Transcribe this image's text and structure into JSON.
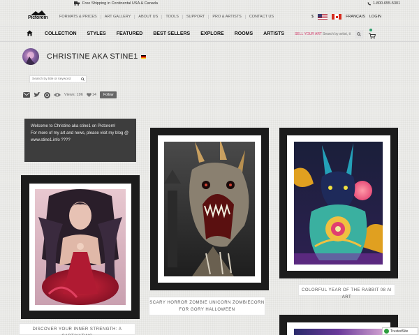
{
  "topbar": {
    "shipping": "Free Shipping in Continental USA & Canada",
    "phone": "1-800-655-5301"
  },
  "brand": {
    "logo": "Pictorem"
  },
  "toplinks": [
    "FORMATS & PRICES",
    "ART GALLERY",
    "ABOUT US",
    "TOOLS",
    "SUPPORT",
    "PRO & ARTISTS",
    "CONTACT US"
  ],
  "right_tools": {
    "currency": "$",
    "language": "FRANÇAIS",
    "login": "LOGIN"
  },
  "catnav": {
    "items": [
      "COLLECTION",
      "STYLES",
      "FEATURED",
      "BEST SELLERS",
      "EXPLORE",
      "ROOMS",
      "ARTISTS"
    ],
    "sell": "SELL YOUR ART",
    "search_placeholder": "Search by artist, ti"
  },
  "profile": {
    "name": "CHRISTINE AKA STINE1",
    "keyword_placeholder": "Search by title or keyword",
    "views": "Views: 196",
    "likes": "14",
    "follow": "Follow"
  },
  "welcome": {
    "lines": [
      "Welcome to Christine aka stine1 on Pictorem!",
      "For more of my art and news, please visit my blog @",
      "www.stine1.info ????"
    ]
  },
  "artworks": [
    {
      "caption_lines": [
        "DISCOVER YOUR INNER STRENGTH: A CAPTIVATING"
      ]
    },
    {
      "caption_lines": [
        "SCARY HORROR ZOMBIE UNICORN ZOMBIECORN",
        "FOR GORY HALLOWEEN"
      ]
    },
    {
      "caption_lines": [
        "COLORFUL YEAR OF THE RABBIT 08 AI ART"
      ]
    }
  ],
  "badge": {
    "trusted": "TrustedSite"
  }
}
